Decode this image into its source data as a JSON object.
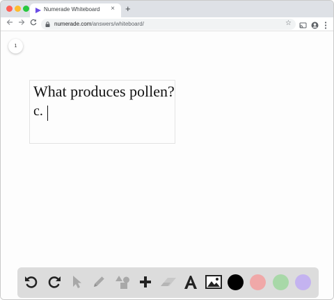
{
  "browser": {
    "tab_title": "Numerade Whiteboard",
    "tab_close": "×",
    "new_tab": "+",
    "url_domain": "numerade.com",
    "url_path": "/answers/whiteboard/"
  },
  "whiteboard": {
    "page_number": "1",
    "question_text": "What produces pollen?",
    "answer_text": "c."
  },
  "palette": {
    "colors": [
      "#000000",
      "#f0a8a8",
      "#a8d8a8",
      "#c4b3f0"
    ]
  }
}
